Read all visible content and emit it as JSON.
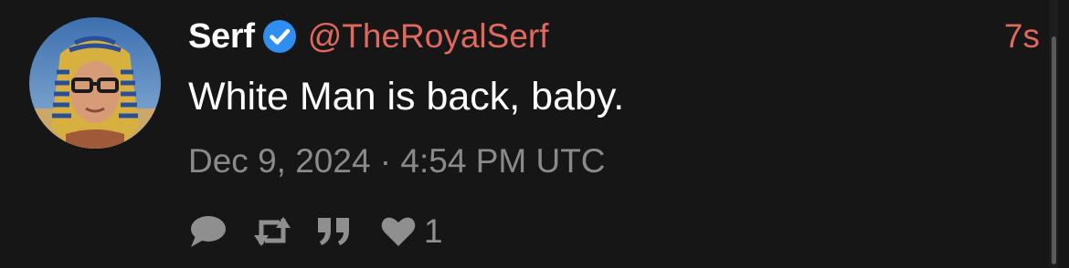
{
  "tweet": {
    "display_name": "Serf",
    "verified": true,
    "handle": "@TheRoyalSerf",
    "time_ago": "7s",
    "text": "White Man is back, baby.",
    "timestamp": "Dec 9, 2024 · 4:54 PM UTC",
    "actions": {
      "reply_icon": "reply-icon",
      "retweet_icon": "retweet-icon",
      "quote_icon": "quote-icon",
      "like_icon": "heart-icon",
      "like_count": "1"
    }
  },
  "colors": {
    "background": "#161616",
    "name": "#ffffff",
    "handle": "#e0685e",
    "muted": "#8a8a8a",
    "verified": "#2f8ff0"
  }
}
